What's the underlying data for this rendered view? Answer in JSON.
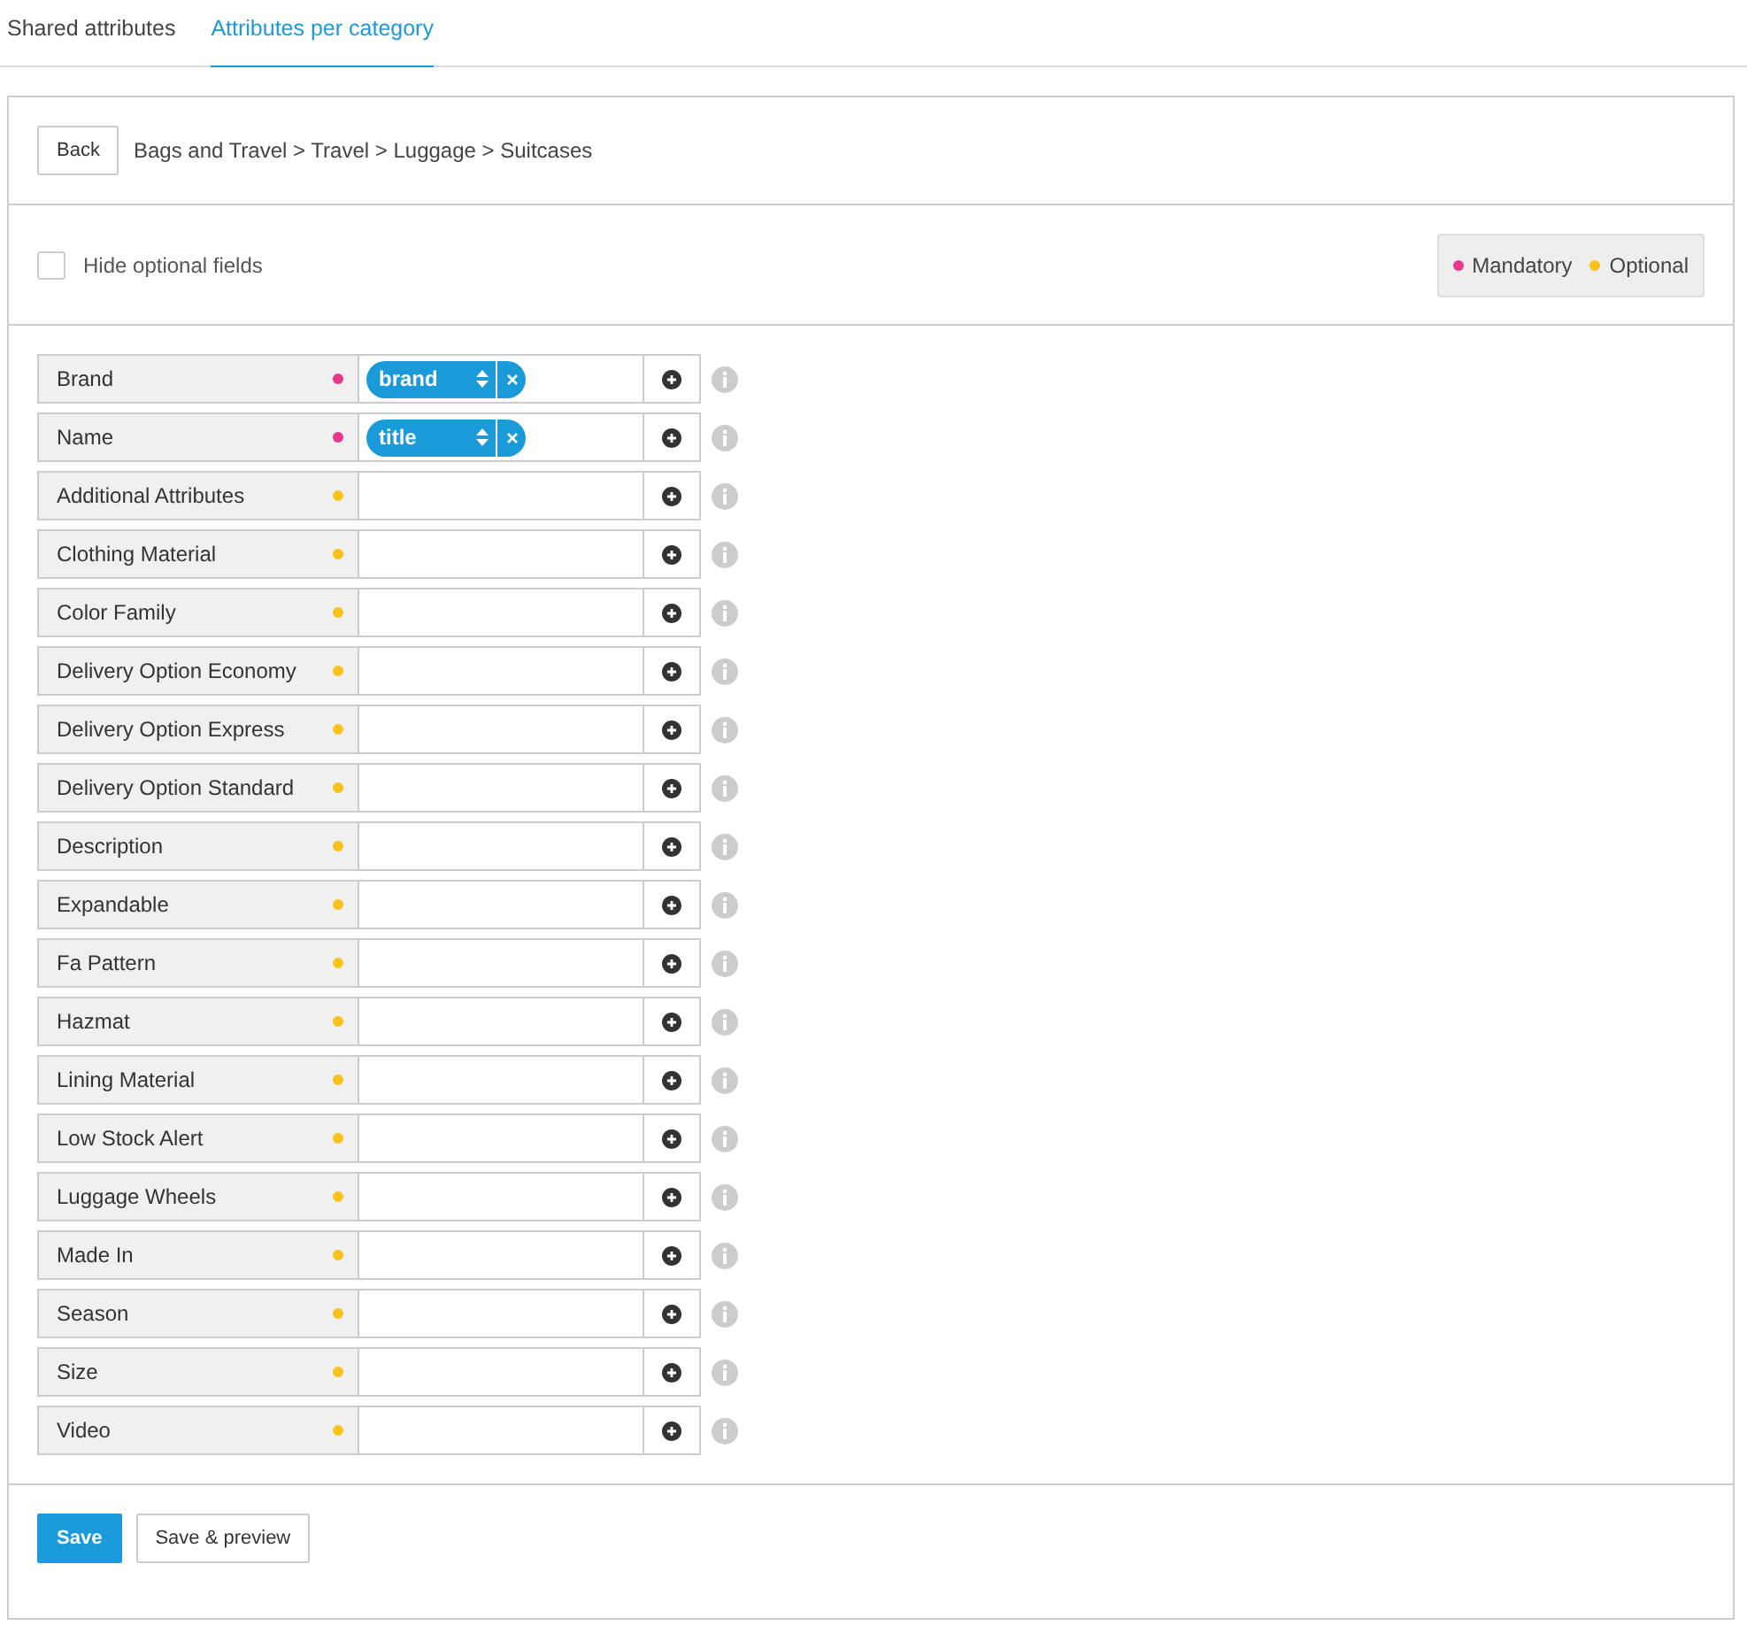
{
  "tabs": [
    {
      "label": "Shared attributes",
      "selected": false
    },
    {
      "label": "Attributes per category",
      "selected": true
    }
  ],
  "header": {
    "back_button": "Back",
    "breadcrumb": "Bags and Travel > Travel > Luggage > Suitcases"
  },
  "filter": {
    "label": "Hide optional fields",
    "checked": false
  },
  "legend": [
    {
      "label": "Mandatory",
      "color": "#e8378a"
    },
    {
      "label": "Optional",
      "color": "#f8c21c"
    }
  ],
  "attributes": [
    {
      "name": "Brand",
      "mandatory": true,
      "mappings": [
        "brand"
      ]
    },
    {
      "name": "Name",
      "mandatory": true,
      "mappings": [
        "title"
      ]
    },
    {
      "name": "Additional Attributes",
      "mandatory": false
    },
    {
      "name": "Clothing Material",
      "mandatory": false
    },
    {
      "name": "Color Family",
      "mandatory": false
    },
    {
      "name": "Delivery Option Economy",
      "mandatory": false
    },
    {
      "name": "Delivery Option Express",
      "mandatory": false
    },
    {
      "name": "Delivery Option Standard",
      "mandatory": false
    },
    {
      "name": "Description",
      "mandatory": false
    },
    {
      "name": "Expandable",
      "mandatory": false
    },
    {
      "name": "Fa Pattern",
      "mandatory": false
    },
    {
      "name": "Hazmat",
      "mandatory": false
    },
    {
      "name": "Lining Material",
      "mandatory": false
    },
    {
      "name": "Low Stock Alert",
      "mandatory": false
    },
    {
      "name": "Luggage Wheels",
      "mandatory": false
    },
    {
      "name": "Made In",
      "mandatory": false
    },
    {
      "name": "Season",
      "mandatory": false
    },
    {
      "name": "Size",
      "mandatory": false
    },
    {
      "name": "Video",
      "mandatory": false
    }
  ],
  "footer": {
    "save_button": "Save",
    "preview_button": "Save & preview"
  }
}
